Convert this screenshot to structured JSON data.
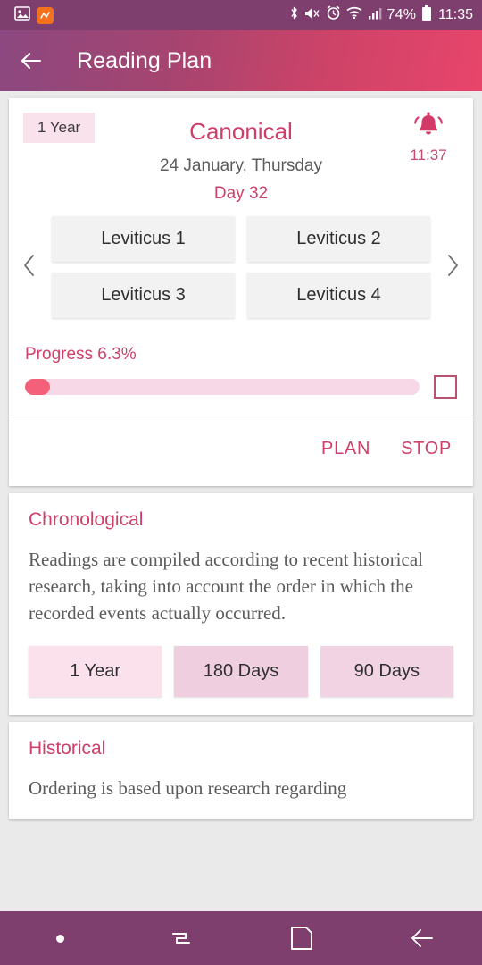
{
  "statusbar": {
    "icons_left": [
      "gallery-icon",
      "orange-app-icon"
    ],
    "icons_right": [
      "bluetooth-icon",
      "mute-icon",
      "alarm-icon",
      "wifi-icon",
      "signal-icon"
    ],
    "battery_percent": "74%",
    "battery_icon": "battery-icon",
    "clock": "11:35",
    "background": "#7E3F6E"
  },
  "appbar": {
    "back_icon": "back-arrow-icon",
    "title": "Reading Plan",
    "gradient_from": "#8B4880",
    "gradient_to": "#E8456A"
  },
  "plan_card": {
    "duration_chip": "1 Year",
    "title": "Canonical",
    "date": "24 January, Thursday",
    "day": "Day 32",
    "alarm_icon": "bell-ringing-icon",
    "alarm_time": "11:37",
    "prev_icon": "chevron-left-icon",
    "next_icon": "chevron-right-icon",
    "chapters": [
      "Leviticus 1",
      "Leviticus 2",
      "Leviticus 3",
      "Leviticus 4"
    ],
    "progress_label": "Progress 6.3%",
    "progress_percent": 6.3,
    "checkbox_checked": false,
    "plan_button": "PLAN",
    "stop_button": "STOP",
    "accent_color": "#CE4069",
    "progress_fill_color": "#F4607A",
    "progress_track_color": "#F6D8E6"
  },
  "info_cards": [
    {
      "title": "Chronological",
      "body": "Readings are compiled according to recent historical research, taking into account the order in which the recorded events actually occurred.",
      "durations": [
        "1 Year",
        "180 Days",
        "90 Days"
      ]
    },
    {
      "title": "Historical",
      "body": "Ordering is based upon research regarding"
    }
  ],
  "navbar": {
    "items": [
      "dot-indicator-icon",
      "recent-apps-icon",
      "home-icon",
      "back-icon"
    ],
    "background": "#7E3F6E"
  }
}
